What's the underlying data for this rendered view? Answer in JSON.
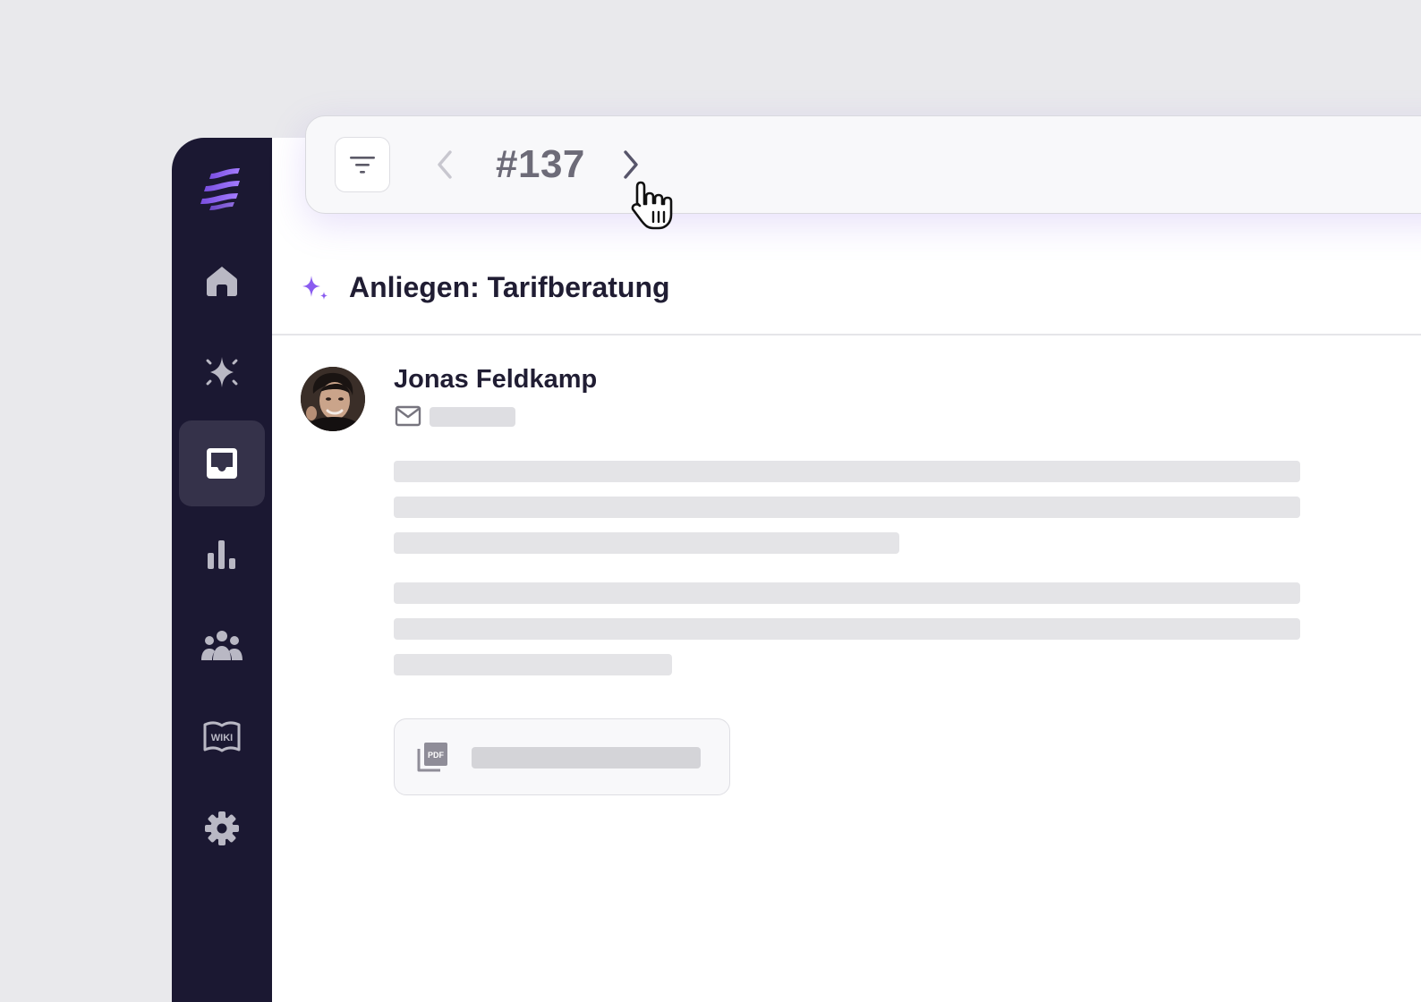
{
  "toolbar": {
    "ticket_number": "#137",
    "filter_icon": "filter-icon",
    "prev_icon": "chevron-left-icon",
    "next_icon": "chevron-right-icon"
  },
  "sidebar": {
    "items": [
      {
        "name": "home",
        "icon": "home-icon",
        "active": false
      },
      {
        "name": "ai",
        "icon": "sparkle-icon",
        "active": false
      },
      {
        "name": "inbox",
        "icon": "inbox-icon",
        "active": true
      },
      {
        "name": "analytics",
        "icon": "bar-chart-icon",
        "active": false
      },
      {
        "name": "team",
        "icon": "users-icon",
        "active": false
      },
      {
        "name": "wiki",
        "icon": "wiki-icon",
        "label": "WIKI",
        "active": false
      },
      {
        "name": "settings",
        "icon": "gear-icon",
        "active": false
      }
    ]
  },
  "ticket": {
    "title": "Anliegen: Tarifberatung",
    "sender_name": "Jonas Feldkamp"
  },
  "colors": {
    "sidebar_bg": "#1b1832",
    "accent": "#8a5cf0",
    "active_item_bg": "#35324a",
    "icon_gray": "#b9b8c4",
    "title_text": "#201d33"
  }
}
